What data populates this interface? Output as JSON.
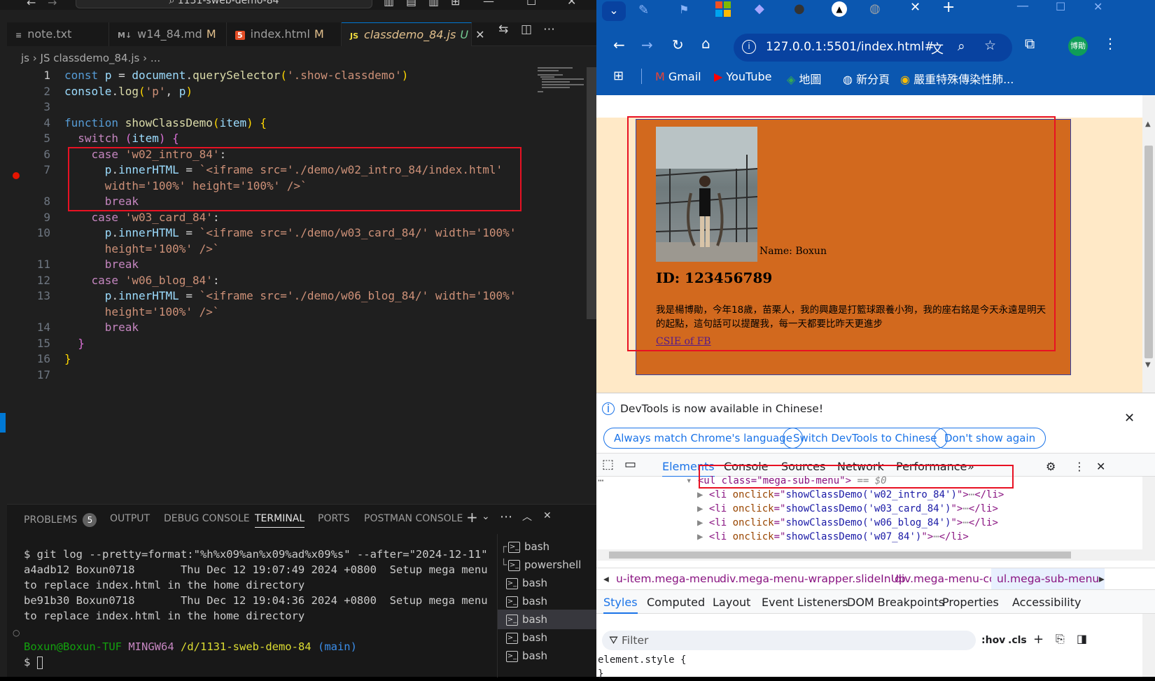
{
  "vscode": {
    "search": "1131-sweb-demo-84",
    "tabs": [
      {
        "label": "note.txt",
        "icon": "≡",
        "mod": ""
      },
      {
        "label": "w14_84.md",
        "icon": "M↓",
        "mod": "M"
      },
      {
        "label": "index.html",
        "icon": "5",
        "mod": "M"
      },
      {
        "label": "classdemo_84.js",
        "icon": "JS",
        "mod": "U"
      }
    ],
    "breadcrumb": "js  ›  JS  classdemo_84.js  ›  ...",
    "code": [
      {
        "n": "1",
        "html": "<span class='kw'>const</span> <span class='vr'>p</span> <span class='pl'>=</span> <span class='vr'>document</span><span class='pl'>.</span><span class='fn'>querySelector</span><span class='br1'>(</span><span class='st'>'.show-classdemo'</span><span class='br1'>)</span>"
      },
      {
        "n": "2",
        "html": "<span class='vr'>console</span><span class='pl'>.</span><span class='fn'>log</span><span class='br1'>(</span><span class='st'>'p'</span><span class='pl'>, </span><span class='vr'>p</span><span class='br1'>)</span>"
      },
      {
        "n": "3",
        "html": ""
      },
      {
        "n": "4",
        "html": "<span class='kw'>function</span> <span class='fn'>showClassDemo</span><span class='br1'>(</span><span class='vr'>item</span><span class='br1'>)</span> <span class='br1'>{</span>"
      },
      {
        "n": "5",
        "html": "  <span class='kc'>switch</span> <span class='br2'>(</span><span class='vr'>item</span><span class='br2'>)</span> <span class='br2'>{</span>"
      },
      {
        "n": "6",
        "html": "    <span class='kc'>case</span> <span class='st'>'w02_intro_84'</span><span class='pl'>:</span>"
      },
      {
        "n": "7",
        "html": "      <span class='vr'>p</span><span class='pl'>.</span><span class='vr'>innerHTML</span> <span class='pl'>=</span> <span class='st'>`&lt;iframe src='./demo/w02_intro_84/index.html'</span>"
      },
      {
        "n": "",
        "html": "      <span class='st'>width='100%' height='100%' /&gt;`</span>"
      },
      {
        "n": "8",
        "html": "      <span class='kc'>break</span>"
      },
      {
        "n": "9",
        "html": "    <span class='kc'>case</span> <span class='st'>'w03_card_84'</span><span class='pl'>:</span>"
      },
      {
        "n": "10",
        "html": "      <span class='vr'>p</span><span class='pl'>.</span><span class='vr'>innerHTML</span> <span class='pl'>=</span> <span class='st'>`&lt;iframe src='./demo/w03_card_84/' width='100%'</span>"
      },
      {
        "n": "",
        "html": "      <span class='st'>height='100%' /&gt;`</span>"
      },
      {
        "n": "11",
        "html": "      <span class='kc'>break</span>"
      },
      {
        "n": "12",
        "html": "    <span class='kc'>case</span> <span class='st'>'w06_blog_84'</span><span class='pl'>:</span>"
      },
      {
        "n": "13",
        "html": "      <span class='vr'>p</span><span class='pl'>.</span><span class='vr'>innerHTML</span> <span class='pl'>=</span> <span class='st'>`&lt;iframe src='./demo/w06_blog_84/' width='100%'</span>"
      },
      {
        "n": "",
        "html": "      <span class='st'>height='100%' /&gt;`</span>"
      },
      {
        "n": "14",
        "html": "      <span class='kc'>break</span>"
      },
      {
        "n": "15",
        "html": "  <span class='br2'>}</span>"
      },
      {
        "n": "16",
        "html": "<span class='br1'>}</span>"
      },
      {
        "n": "17",
        "html": ""
      }
    ],
    "panel_tabs": [
      "PROBLEMS",
      "OUTPUT",
      "DEBUG CONSOLE",
      "TERMINAL",
      "PORTS",
      "POSTMAN CONSOLE"
    ],
    "problems_count": "5",
    "terminal": [
      "$ git log --pretty=format:\"%h%x09%an%x09%ad%x09%s\" --after=\"2024-12-11\"",
      "a4adb12 Boxun0718       Thu Dec 12 19:07:49 2024 +0800  Setup mega menu",
      "to replace index.html in the home directory",
      "be91b30 Boxun0718       Thu Dec 12 19:04:36 2024 +0800  Setup mega menu",
      "to replace index.html in the home directory"
    ],
    "prompt_user": "Boxun@Boxun-TUF",
    "prompt_env": "MINGW64",
    "prompt_path": "/d/1131-sweb-demo-84",
    "prompt_branch": "(main)",
    "prompt_symbol": "$",
    "terminals": [
      "bash",
      "powershell",
      "bash",
      "bash",
      "bash",
      "bash",
      "bash"
    ]
  },
  "chrome": {
    "url": "127.0.0.1:5501/index.html#",
    "profile": "博勛",
    "bookmarks": [
      "Gmail",
      "YouTube",
      "地圖",
      "新分頁",
      "嚴重特殊傳染性肺..."
    ],
    "page": {
      "name_label": "Name: Boxun",
      "id": "ID: 123456789",
      "bio": "我是楊博勛，今年18歲，苗栗人，我的興趣是打籃球跟養小狗，我的座右銘是今天永遠是明天的起點，這句話可以提醒我，每一天都要比昨天更進步",
      "link": "CSIE of FB"
    },
    "devtools": {
      "notice": "DevTools is now available in Chinese!",
      "notice_buttons": [
        "Always match Chrome's language",
        "Switch DevTools to Chinese",
        "Don't show again"
      ],
      "tabs": [
        "Elements",
        "Console",
        "Sources",
        "Network",
        "Performance"
      ],
      "dom_ul": "<ul class=\"mega-sub-menu\">",
      "dom_ul_suffix": "== $0",
      "dom_items": [
        "showClassDemo('w02_intro_84')",
        "showClassDemo('w03_card_84')",
        "showClassDemo('w06_blog_84')",
        "showClassDemo('w07_84')"
      ],
      "crumbs": [
        "u-item.mega-menu",
        "div.mega-menu-wrapper.slideInUp",
        "div.mega-menu-col",
        "ul.mega-sub-menu"
      ],
      "subtabs": [
        "Styles",
        "Computed",
        "Layout",
        "Event Listeners",
        "DOM Breakpoints",
        "Properties",
        "Accessibility"
      ],
      "filter": "Filter",
      "hov": ":hov",
      "cls": ".cls",
      "style_rule": "element.style {\n}"
    }
  }
}
